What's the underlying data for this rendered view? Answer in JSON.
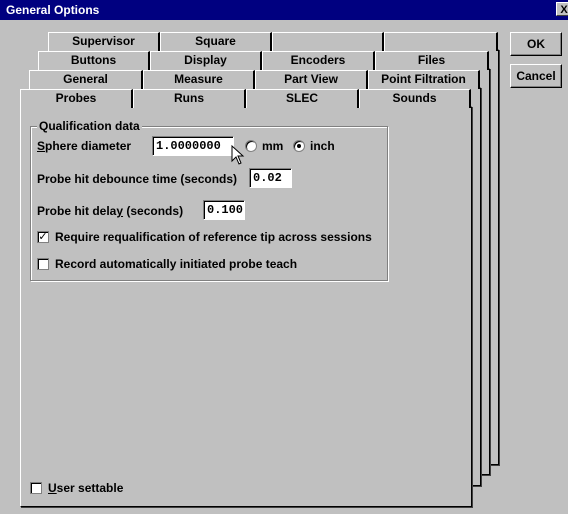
{
  "window": {
    "title": "General Options",
    "close_glyph": "X"
  },
  "tabs": {
    "row4": [
      "Supervisor",
      "Square",
      "",
      ""
    ],
    "row3": [
      "Buttons",
      "Display",
      "Encoders",
      "Files"
    ],
    "row2": [
      "General",
      "Measure",
      "Part View",
      "Point Filtration"
    ],
    "row1": [
      "Probes",
      "Runs",
      "SLEC",
      "Sounds"
    ],
    "selected": "Probes"
  },
  "buttons": {
    "ok": "OK",
    "cancel": "Cancel"
  },
  "qualification": {
    "legend": "Qualification data",
    "sphere_label_first": "S",
    "sphere_label_rest": "phere diameter",
    "sphere_value": "1.0000000",
    "unit_mm": "mm",
    "unit_inch": "inch",
    "unit_selected": "inch",
    "debounce_label": "Probe hit debounce time (seconds)",
    "debounce_value": "0.02",
    "delay_label_a": "Probe hit dela",
    "delay_label_u": "y",
    "delay_label_b": " (seconds)",
    "delay_value": "0.100",
    "requalify_label": "Require requalification of reference tip across sessions",
    "requalify_checked": true,
    "record_label": "Record automatically initiated probe teach",
    "record_checked": false
  },
  "user_settable": {
    "label_first": "U",
    "label_rest": "ser settable",
    "checked": false
  },
  "check_glyph": "✓"
}
